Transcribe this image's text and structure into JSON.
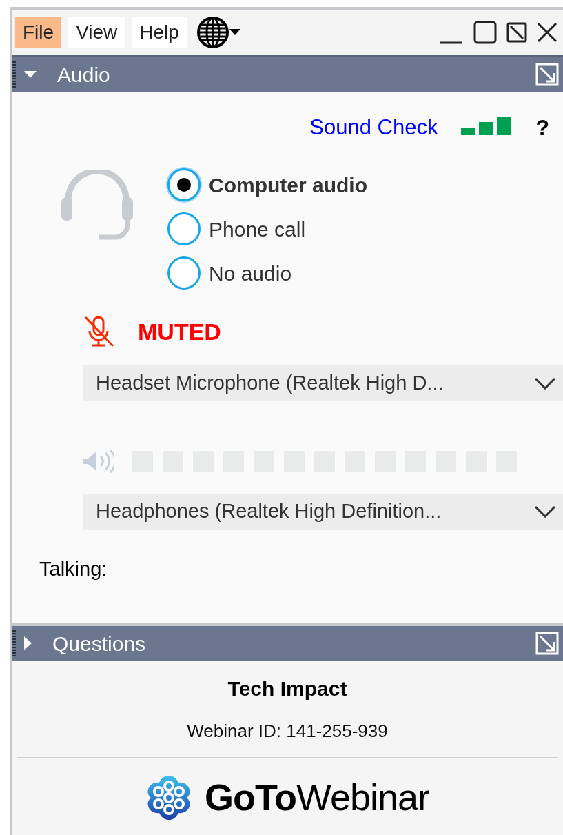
{
  "menu": [
    {
      "label": "File",
      "selected": true
    },
    {
      "label": "View",
      "selected": false
    },
    {
      "label": "Help",
      "selected": false
    }
  ],
  "audio_panel": {
    "title": "Audio",
    "expanded": true,
    "sound_check": "Sound Check",
    "help": "?",
    "options": [
      {
        "label": "Computer audio",
        "selected": true
      },
      {
        "label": "Phone call",
        "selected": false
      },
      {
        "label": "No audio",
        "selected": false
      }
    ],
    "mic": {
      "muted": true,
      "status": "MUTED",
      "device": "Headset Microphone (Realtek High D..."
    },
    "speaker": {
      "level": 0,
      "device": "Headphones (Realtek High Definition..."
    },
    "talking_label": "Talking:"
  },
  "questions_panel": {
    "title": "Questions",
    "expanded": false
  },
  "footer": {
    "organizer": "Tech Impact",
    "webinar_id": "Webinar ID: 141-255-939",
    "logo_text": "**GoTo**Webinar"
  }
}
